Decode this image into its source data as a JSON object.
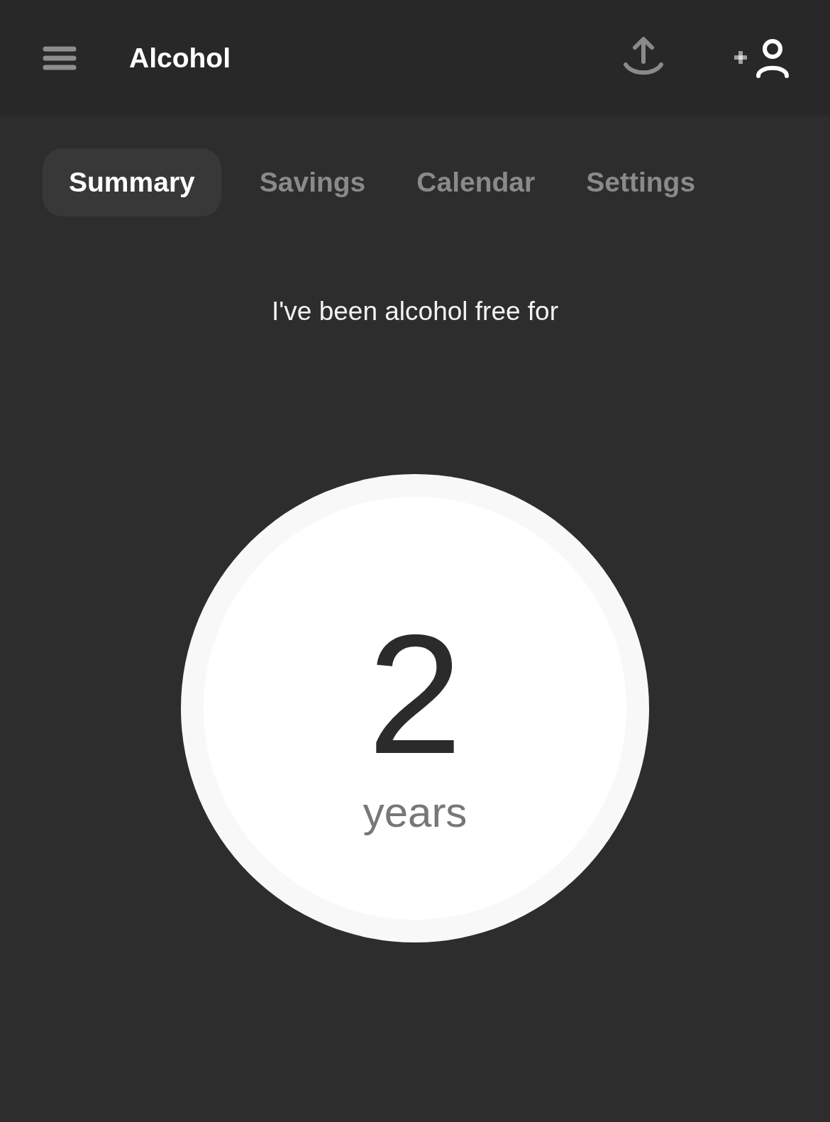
{
  "header": {
    "title": "Alcohol"
  },
  "tabs": [
    {
      "label": "Summary",
      "selected": true
    },
    {
      "label": "Savings",
      "selected": false
    },
    {
      "label": "Calendar",
      "selected": false
    },
    {
      "label": "Settings",
      "selected": false
    }
  ],
  "summary": {
    "caption": "I've been alcohol free for",
    "count": "2",
    "unit": "years"
  }
}
